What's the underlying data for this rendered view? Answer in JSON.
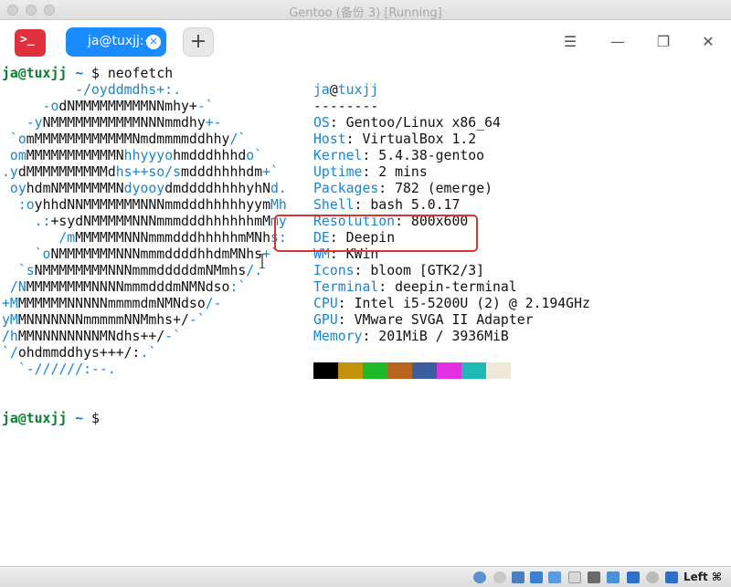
{
  "window": {
    "title": "Gentoo (备份 3) [Running]"
  },
  "header": {
    "app_icon_glyph": ">_",
    "tab_label": "ja@tuxjj:~",
    "tab_close_glyph": "×",
    "add_tab_glyph": "+",
    "menu_glyph": "☰",
    "minimize_glyph": "—",
    "maximize_glyph": "❐",
    "close_glyph": "✕"
  },
  "terminal": {
    "prompt": {
      "user": "ja@tuxjj",
      "dir": "~",
      "sign": "$"
    },
    "command": "neofetch",
    "ascii": [
      [
        "         ",
        "-/oyddmdhs+:."
      ],
      [
        "     ",
        "-o",
        "dNMMMMMMMMMNNmhy+",
        "-`"
      ],
      [
        "   ",
        "-y",
        "NMMMMMMMMMMMNNNmmdhy",
        "+-"
      ],
      [
        " ",
        "`o",
        "mMMMMMMMMMMMMNmdmmmmddhhy",
        "/`"
      ],
      [
        " ",
        "om",
        "MMMMMMMMMMMN",
        "hhyyyo",
        "hmdddhhhd",
        "o`"
      ],
      [
        "",
        ".y",
        "dMMMMMMMMMMd",
        "hs++so/s",
        "mdddhhhhdm",
        "+`"
      ],
      [
        " ",
        "oy",
        "hdmNMMMMMMMN",
        "dyooy",
        "dmddddhhhhyhN",
        "d."
      ],
      [
        "  ",
        ":o",
        "yhhdNNMMMMMMMNNNmmdddhhhhhyym",
        "Mh"
      ],
      [
        "    ",
        ".:",
        "+sydNMMMMMNNNmmmdddhhhhhhmM",
        "my"
      ],
      [
        "       ",
        "/m",
        "MMMMMMNNNmmmdddhhhhhmMNh",
        "s:"
      ],
      [
        "    ",
        "`o",
        "NMMMMMMMNNNmmmddddhhdmMNhs",
        "+`"
      ],
      [
        "  ",
        "`s",
        "NMMMMMMMMNNNmmmdddddmNMmhs",
        "/."
      ],
      [
        " ",
        "/N",
        "MMMMMMMMNNNNmmmdddmNMNdso",
        ":`"
      ],
      [
        "",
        "+M",
        "MMMMMMNNNNNmmmmdmNMNdso",
        "/-"
      ],
      [
        "",
        "yM",
        "MNNNNNNNmmmmmNNMmhs+/",
        "-`"
      ],
      [
        "",
        "/h",
        "MMNNNNNNNNMNdhs++/",
        "-`"
      ],
      [
        "",
        "`/",
        "ohdmmddhys+++/:",
        ".`"
      ],
      [
        "  ",
        "`-//////:--."
      ]
    ],
    "info": {
      "user": "ja",
      "at": "@",
      "host": "tuxjj",
      "separator": "--------",
      "rows": [
        {
          "key": "OS",
          "value": "Gentoo/Linux x86_64"
        },
        {
          "key": "Host",
          "value": "VirtualBox 1.2"
        },
        {
          "key": "Kernel",
          "value": "5.4.38-gentoo"
        },
        {
          "key": "Uptime",
          "value": "2 mins"
        },
        {
          "key": "Packages",
          "value": "782 (emerge)"
        },
        {
          "key": "Shell",
          "value": "bash 5.0.17"
        },
        {
          "key": "Resolution",
          "value": "800x600"
        },
        {
          "key": "DE",
          "value": "Deepin"
        },
        {
          "key": "WM",
          "value": "KWin"
        },
        {
          "key": "Icons",
          "value": "bloom [GTK2/3]"
        },
        {
          "key": "Terminal",
          "value": "deepin-terminal"
        },
        {
          "key": "CPU",
          "value": "Intel i5-5200U (2) @ 2.194GHz"
        },
        {
          "key": "GPU",
          "value": "VMware SVGA II Adapter"
        },
        {
          "key": "Memory",
          "value": "201MiB / 3936MiB"
        }
      ],
      "swatches": [
        "#000000",
        "#c4910a",
        "#1fb829",
        "#b8651f",
        "#3a5fa0",
        "#e22fe0",
        "#1fb8b4",
        "#efe8d8"
      ]
    },
    "highlight_color": "#e03030"
  },
  "statusbar": {
    "host_key": "Left ⌘"
  }
}
